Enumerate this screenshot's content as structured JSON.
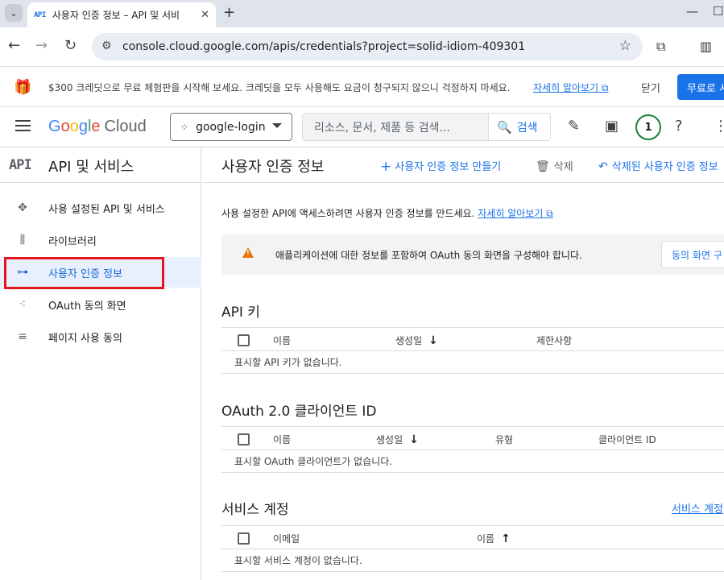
{
  "browser": {
    "tab_favicon": "API",
    "tab_title": "사용자 인증 정보 – API 및 서비",
    "url": "console.cloud.google.com/apis/credentials?project=solid-idiom-409301"
  },
  "promo": {
    "text": "$300 크레딧으로 무료 체험판을 시작해 보세요. 크레딧을 모두 사용해도 요금이 청구되지 않으니 걱정하지 마세요.",
    "link": "자세히 알아보기",
    "dismiss": "닫기",
    "cta": "무료로 시"
  },
  "header": {
    "logo_g": "G",
    "logo_o1": "o",
    "logo_o2": "o",
    "logo_g2": "g",
    "logo_l": "l",
    "logo_e": "e",
    "logo_cloud": "Cloud",
    "project": "google-login",
    "search_placeholder": "리소스, 문서, 제품 등 검색...",
    "search_button": "검색",
    "notifications_count": "1"
  },
  "sidebar": {
    "logo": "API",
    "title": "API 및 서비스",
    "items": [
      {
        "label": "사용 설정된 API 및 서비스",
        "icon": "apis-diamond-icon"
      },
      {
        "label": "라이브러리",
        "icon": "library-icon"
      },
      {
        "label": "사용자 인증 정보",
        "icon": "key-icon",
        "active": true
      },
      {
        "label": "OAuth 동의 화면",
        "icon": "oauth-dots-icon"
      },
      {
        "label": "페이지 사용 동의",
        "icon": "settings-list-icon"
      }
    ]
  },
  "main": {
    "title": "사용자 인증 정보",
    "create_button": "사용자 인증 정보 만들기",
    "delete_button": "삭제",
    "restore_button": "삭제된 사용자 인증 정보",
    "intro_text": "사용 설정한 API에 액세스하려면 사용자 인증 정보를 만드세요.",
    "intro_link": "자세히 알아보기",
    "warning_text": "애플리케이션에 대한 정보를 포함하여 OAuth 동의 화면을 구성해야 합니다.",
    "warning_button": "동의 화면 구"
  },
  "api_keys": {
    "title": "API 키",
    "columns": [
      "이름",
      "생성일",
      "제한사항"
    ],
    "empty": "표시할 API 키가 없습니다."
  },
  "oauth": {
    "title": "OAuth 2.0 클라이언트 ID",
    "columns": [
      "이름",
      "생성일",
      "유형",
      "클라이언트 ID"
    ],
    "empty": "표시할 OAuth 클라이언트가 없습니다."
  },
  "service_accounts": {
    "title": "서비스 계정",
    "manage_link": "서비스 계정",
    "columns": [
      "이메일",
      "이름"
    ],
    "empty": "표시할 서비스 계정이 없습니다."
  },
  "colors": {
    "accent": "#1a73e8",
    "active_bg": "#e8f0fe",
    "highlight": "#e3161b",
    "warning": "#e37400"
  }
}
